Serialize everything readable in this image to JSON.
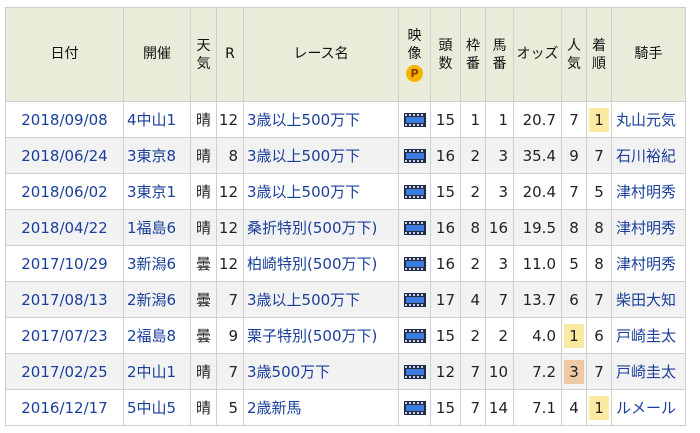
{
  "headers": {
    "date": "日付",
    "venue": "開催",
    "weather": [
      "天",
      "気"
    ],
    "race_no": "R",
    "race_name": "レース名",
    "video": [
      "映",
      "像"
    ],
    "video_badge": "P",
    "field_size": [
      "頭",
      "数"
    ],
    "frame_no": [
      "枠",
      "番"
    ],
    "horse_no": [
      "馬",
      "番"
    ],
    "odds": "オッズ",
    "favorite": [
      "人",
      "気"
    ],
    "finish": [
      "着",
      "順"
    ],
    "jockey": "騎手"
  },
  "rows": [
    {
      "date": "2018/09/08",
      "venue": "4中山1",
      "weather": "晴",
      "race_no": "12",
      "race_name": "3歳以上500万下",
      "field_size": "15",
      "frame_no": "1",
      "horse_no": "1",
      "odds": "20.7",
      "favorite": "7",
      "finish": "1",
      "jockey": "丸山元気"
    },
    {
      "date": "2018/06/24",
      "venue": "3東京8",
      "weather": "晴",
      "race_no": "8",
      "race_name": "3歳以上500万下",
      "field_size": "16",
      "frame_no": "2",
      "horse_no": "3",
      "odds": "35.4",
      "favorite": "9",
      "finish": "7",
      "jockey": "石川裕紀"
    },
    {
      "date": "2018/06/02",
      "venue": "3東京1",
      "weather": "晴",
      "race_no": "12",
      "race_name": "3歳以上500万下",
      "field_size": "15",
      "frame_no": "2",
      "horse_no": "3",
      "odds": "20.4",
      "favorite": "7",
      "finish": "5",
      "jockey": "津村明秀"
    },
    {
      "date": "2018/04/22",
      "venue": "1福島6",
      "weather": "晴",
      "race_no": "12",
      "race_name": "桑折特別(500万下)",
      "field_size": "16",
      "frame_no": "8",
      "horse_no": "16",
      "odds": "19.5",
      "favorite": "8",
      "finish": "8",
      "jockey": "津村明秀"
    },
    {
      "date": "2017/10/29",
      "venue": "3新潟6",
      "weather": "曇",
      "race_no": "12",
      "race_name": "柏崎特別(500万下)",
      "field_size": "16",
      "frame_no": "2",
      "horse_no": "3",
      "odds": "11.0",
      "favorite": "5",
      "finish": "8",
      "jockey": "津村明秀"
    },
    {
      "date": "2017/08/13",
      "venue": "2新潟6",
      "weather": "曇",
      "race_no": "7",
      "race_name": "3歳以上500万下",
      "field_size": "17",
      "frame_no": "4",
      "horse_no": "7",
      "odds": "13.7",
      "favorite": "6",
      "finish": "7",
      "jockey": "柴田大知"
    },
    {
      "date": "2017/07/23",
      "venue": "2福島8",
      "weather": "曇",
      "race_no": "9",
      "race_name": "栗子特別(500万下)",
      "field_size": "15",
      "frame_no": "2",
      "horse_no": "2",
      "odds": "4.0",
      "favorite": "1",
      "finish": "6",
      "jockey": "戸崎圭太"
    },
    {
      "date": "2017/02/25",
      "venue": "2中山1",
      "weather": "晴",
      "race_no": "7",
      "race_name": "3歳500万下",
      "field_size": "12",
      "frame_no": "7",
      "horse_no": "10",
      "odds": "7.2",
      "favorite": "3",
      "finish": "7",
      "jockey": "戸崎圭太"
    },
    {
      "date": "2016/12/17",
      "venue": "5中山5",
      "weather": "晴",
      "race_no": "5",
      "race_name": "2歳新馬",
      "field_size": "15",
      "frame_no": "7",
      "horse_no": "14",
      "odds": "7.1",
      "favorite": "4",
      "finish": "1",
      "jockey": "ルメール"
    }
  ],
  "highlights": {
    "place_1_color": "#fbeba0",
    "place_3_color": "#efc9a6",
    "header_bg": "#e9ecd9",
    "link_color": "#1a3f9a"
  },
  "icons": {
    "video": "video-icon",
    "premium": "p-badge-icon"
  }
}
